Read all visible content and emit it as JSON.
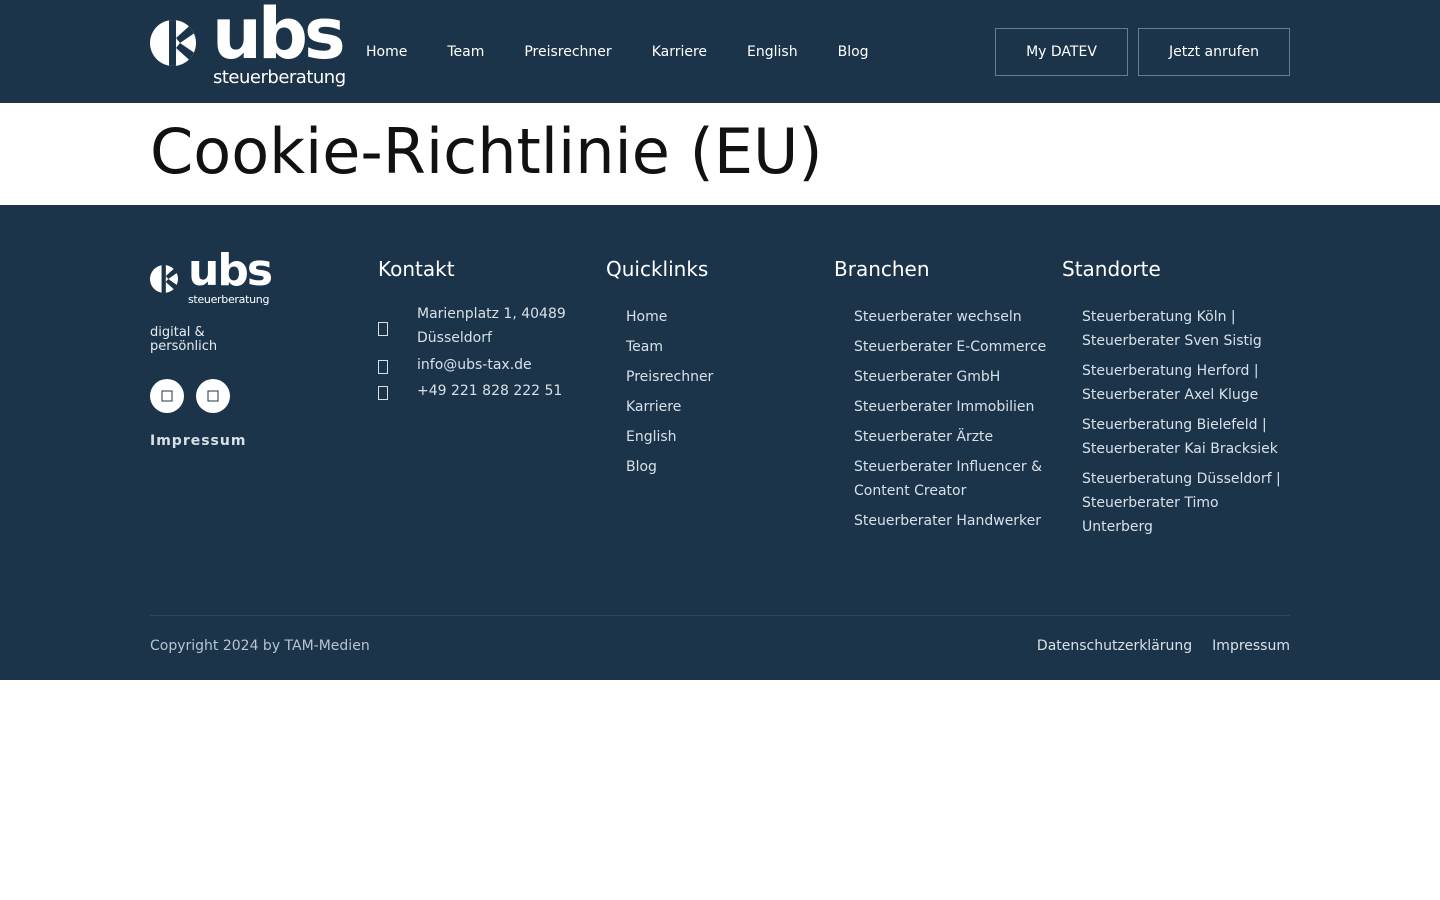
{
  "header": {
    "logo_text": "ubs",
    "logo_sub": "steuerberatung",
    "nav": [
      "Home",
      "Team",
      "Preisrechner",
      "Karriere",
      "English",
      "Blog"
    ],
    "btn_datev": "My DATEV",
    "btn_call": "Jetzt anrufen"
  },
  "page": {
    "title": "Cookie-Richtlinie (EU)"
  },
  "footer": {
    "logo_text": "ubs",
    "logo_sub": "steuerberatung",
    "tagline": "digital & persönlich",
    "impressum_label": "Impressum",
    "kontakt": {
      "title": "Kontakt",
      "address": "Marienplatz 1, 40489 Düsseldorf",
      "email": "info@ubs-tax.de",
      "phone": "+49 221 828 222 51"
    },
    "quicklinks": {
      "title": "Quicklinks",
      "items": [
        "Home",
        "Team",
        "Preisrechner",
        "Karriere",
        "English",
        "Blog"
      ]
    },
    "branchen": {
      "title": "Branchen",
      "items": [
        "Steuerberater wechseln",
        "Steuerberater E-Commerce",
        "Steuerberater GmbH",
        "Steuerberater Immobilien",
        "Steuerberater Ärzte",
        "Steuerberater Influencer & Content Creator",
        "Steuerberater Handwerker"
      ]
    },
    "standorte": {
      "title": "Standorte",
      "items": [
        "Steuerberatung Köln | Steuerberater Sven Sistig",
        "Steuerberatung Herford | Steuerberater Axel Kluge",
        "Steuerberatung Bielefeld | Steuerberater Kai Bracksiek",
        "Steuerberatung Düsseldorf | Steuerberater Timo Unterberg"
      ]
    },
    "copyright": "Copyright 2024 by TAM-Medien",
    "bottom_links": [
      "Datenschutzerklärung",
      "Impressum"
    ]
  },
  "colors": {
    "navy": "#1c344a",
    "white": "#ffffff"
  }
}
